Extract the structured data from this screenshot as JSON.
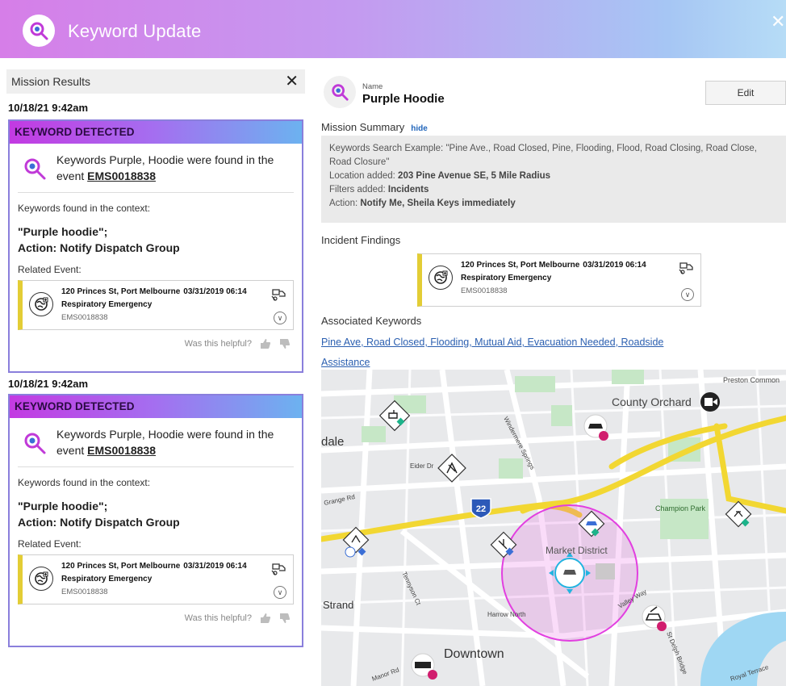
{
  "app": {
    "title": "Keyword Update",
    "close_glyph": "✕"
  },
  "results": {
    "header": "Mission Results",
    "close_glyph": "✕",
    "alerts": [
      {
        "timestamp": "10/18/21  9:42am",
        "banner": "KEYWORD DETECTED",
        "found_text": "Keywords Purple, Hoodie were found in the event ",
        "event_id": "EMS0018838",
        "context_label": "Keywords found in the context:",
        "quote": "\"Purple hoodie\";",
        "action_label": "Action: ",
        "action_value": "Notify Dispatch Group",
        "related_label": "Related Event:",
        "event": {
          "address": "120 Princes St, Port Melbourne",
          "date": "03/31/2019 06:14",
          "type": "Respiratory Emergency",
          "id": "EMS0018838"
        },
        "helpful": "Was this helpful?"
      },
      {
        "timestamp": "10/18/21  9:42am",
        "banner": "KEYWORD DETECTED",
        "found_text": "Keywords Purple, Hoodie were found in the event ",
        "event_id": "EMS0018838",
        "context_label": "Keywords found in the context:",
        "quote": "\"Purple hoodie\";",
        "action_label": "Action: ",
        "action_value": "Notify Dispatch Group",
        "related_label": "Related Event:",
        "event": {
          "address": "120 Princes St, Port Melbourne",
          "date": "03/31/2019 06:14",
          "type": "Respiratory Emergency",
          "id": "EMS0018838"
        },
        "helpful": "Was this helpful?"
      }
    ]
  },
  "mission": {
    "name_label": "Name",
    "name": "Purple Hoodie",
    "edit_label": "Edit",
    "summary_title": "Mission Summary",
    "hide_label": "hide",
    "summary": {
      "keywords_line": "Keywords Search Example: \"Pine Ave., Road Closed, Pine, Flooding, Flood, Road Closing, Road Close, Road Closure\"",
      "location_label": "Location added: ",
      "location_value": "203 Pine Avenue SE, 5 Mile Radius",
      "filters_label": "Filters added: ",
      "filters_value": "Incidents",
      "action_label": "Action: ",
      "action_value": "Notify Me, Sheila Keys immediately"
    },
    "findings_title": "Incident Findings",
    "finding_event": {
      "address": "120 Princes St, Port Melbourne",
      "date": "03/31/2019 06:14",
      "type": "Respiratory Emergency",
      "id": "EMS0018838"
    },
    "assoc_title": "Associated Keywords",
    "assoc_keywords": "Pine Ave, Road Closed, Flooding, Mutual Aid, Evacuation Needed, Roadside Assistance"
  },
  "map": {
    "labels": {
      "preston": "Preston Common",
      "county_orchard": "County Orchard",
      "dale": "dale",
      "windermere": "Windermere Springs",
      "eider": "Eider Dr",
      "grange": "Grange Rd",
      "champion": "Champion Park",
      "highway": "22",
      "market": "Market District",
      "tennyson": "Tennyson Ct",
      "valley": "Valley Way",
      "strand": "Strand",
      "harrow": "Harrow North",
      "downtown": "Downtown",
      "manor": "Manor Rd",
      "royal": "Royal Terrace",
      "delph": "St Delph Bridge"
    },
    "colors": {
      "radius": "#e23fe0",
      "road": "#f2d732",
      "water": "#9fd7f3",
      "park": "#c6e7c6",
      "accent": "#22b4e0"
    }
  }
}
